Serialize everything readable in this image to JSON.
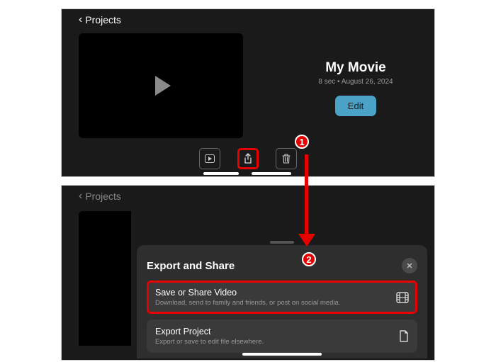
{
  "colors": {
    "accent": "#4aa3c6",
    "highlight": "#e60000"
  },
  "screen1": {
    "nav_back": "Projects",
    "project_title": "My Movie",
    "meta": "8 sec • August 26, 2024",
    "edit_label": "Edit",
    "toolbar": {
      "play": "play-video-button",
      "share": "share-button",
      "delete": "delete-button"
    }
  },
  "screen2": {
    "nav_back": "Projects",
    "sheet_title": "Export and Share",
    "items": [
      {
        "title": "Save or Share Video",
        "subtitle": "Download, send to family and friends, or post on social media.",
        "icon": "film-icon"
      },
      {
        "title": "Export Project",
        "subtitle": "Export or save to edit file elsewhere.",
        "icon": "document-icon"
      }
    ]
  },
  "callouts": {
    "one": "1",
    "two": "2"
  }
}
